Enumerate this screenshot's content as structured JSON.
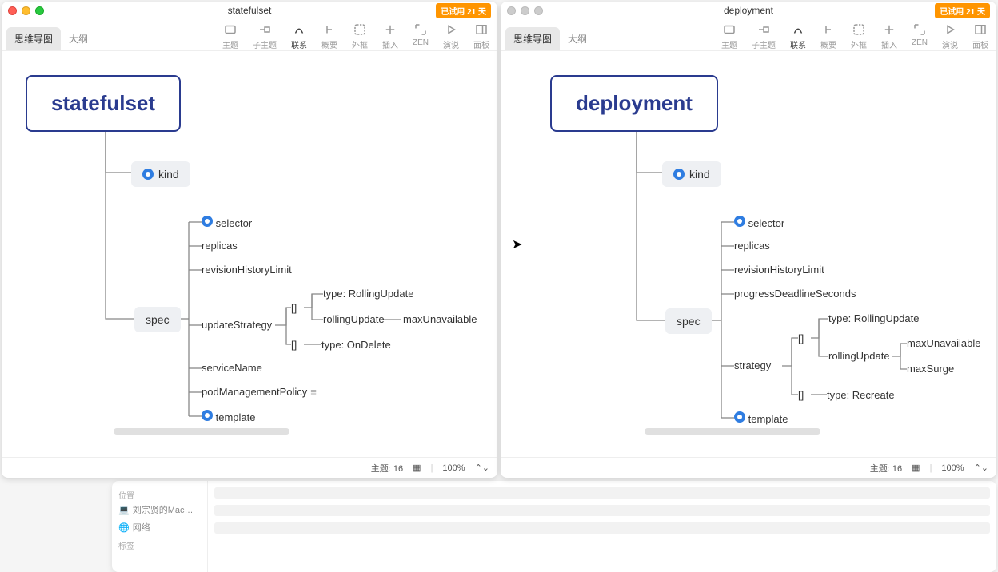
{
  "leftPane": {
    "title": "statefulset",
    "trialBadge": "已试用 21 天",
    "tabs": {
      "mindmap": "思维导图",
      "outline": "大纲"
    },
    "toolbar": {
      "topic": "主题",
      "subtopic": "子主题",
      "relation": "联系",
      "summary": "概要",
      "boundary": "外框",
      "insert": "插入",
      "zen": "ZEN",
      "present": "演说",
      "panel": "面板"
    },
    "map": {
      "root": "statefulset",
      "kind": "kind",
      "spec": "spec",
      "spec_children": {
        "selector": "selector",
        "replicas": "replicas",
        "revisionHistoryLimit": "revisionHistoryLimit",
        "updateStrategy": "updateStrategy",
        "us_item1": "[]",
        "us_item1_a": "type: RollingUpdate",
        "us_item1_b": "rollingUpdate",
        "us_item1_b_1": "maxUnavailable",
        "us_item2": "[]",
        "us_item2_a": "type: OnDelete",
        "serviceName": "serviceName",
        "podManagementPolicy": "podManagementPolicy",
        "template": "template"
      }
    },
    "status": {
      "topics": "主题: 16",
      "zoom": "100%"
    }
  },
  "rightPane": {
    "title": "deployment",
    "trialBadge": "已试用 21 天",
    "tabs": {
      "mindmap": "思维导图",
      "outline": "大纲"
    },
    "toolbar": {
      "topic": "主题",
      "subtopic": "子主题",
      "relation": "联系",
      "summary": "概要",
      "boundary": "外框",
      "insert": "插入",
      "zen": "ZEN",
      "present": "演说",
      "panel": "面板"
    },
    "map": {
      "root": "deployment",
      "kind": "kind",
      "spec": "spec",
      "spec_children": {
        "selector": "selector",
        "replicas": "replicas",
        "revisionHistoryLimit": "revisionHistoryLimit",
        "progressDeadlineSeconds": "progressDeadlineSeconds",
        "strategy": "strategy",
        "s_item1": "[]",
        "s_item1_a": "type: RollingUpdate",
        "s_item1_b": "rollingUpdate",
        "s_item1_b_1": "maxUnavailable",
        "s_item1_b_2": "maxSurge",
        "s_item2": "[]",
        "s_item2_a": "type: Recreate",
        "template": "template"
      }
    },
    "status": {
      "topics": "主题: 16",
      "zoom": "100%"
    }
  },
  "finder": {
    "sidebar": {
      "locationHeader": "位置",
      "mac": "刘宗贤的Mac…",
      "network": "网络",
      "tagsHeader": "标签"
    }
  }
}
